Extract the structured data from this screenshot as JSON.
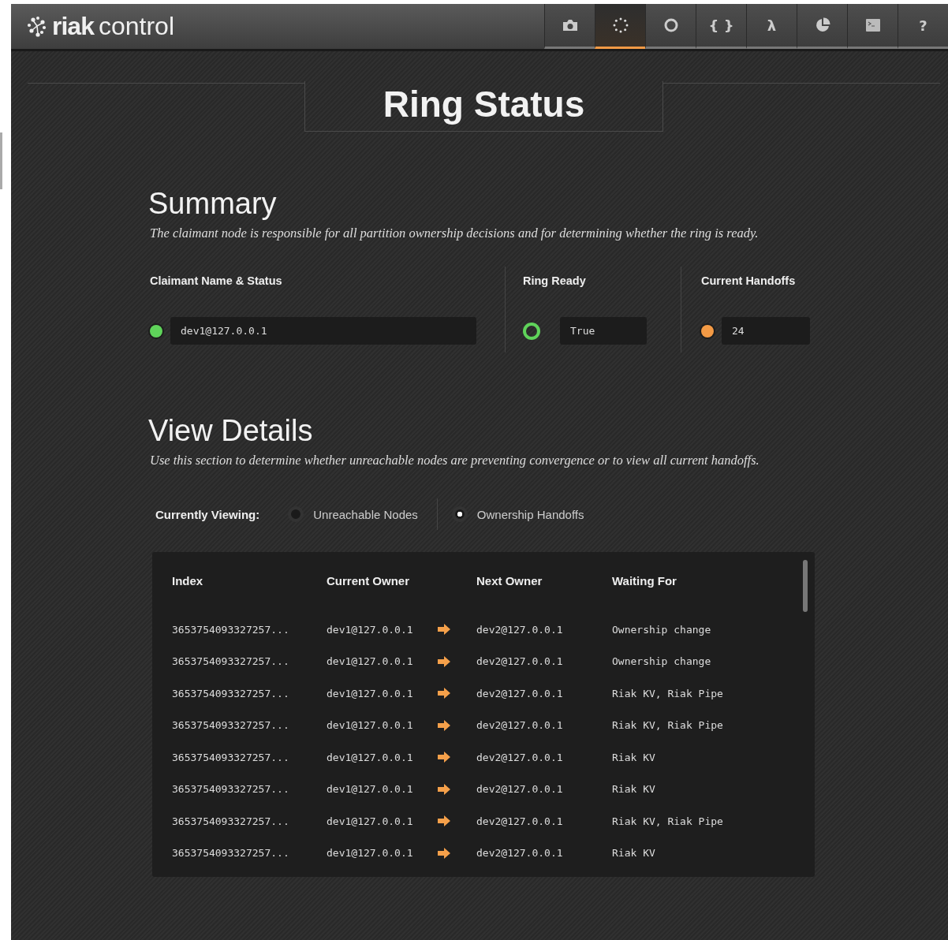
{
  "header": {
    "logo_bold": "riak",
    "logo_light": "control",
    "nav": [
      {
        "kind": "camera",
        "selected": false
      },
      {
        "kind": "ring",
        "selected": true
      },
      {
        "kind": "circle",
        "selected": false
      },
      {
        "kind": "text",
        "label": "{ }",
        "selected": false
      },
      {
        "kind": "text",
        "label": "λ",
        "selected": false
      },
      {
        "kind": "pie",
        "selected": false
      },
      {
        "kind": "terminal",
        "selected": false
      },
      {
        "kind": "text",
        "label": "?",
        "selected": false
      }
    ]
  },
  "page_title": "Ring Status",
  "summary": {
    "heading": "Summary",
    "description": "The claimant node is responsible for all partition ownership decisions and for determining whether the ring is ready.",
    "fields": [
      {
        "label": "Claimant Name & Status",
        "value": "dev1@127.0.0.1",
        "kind": "dot",
        "color": "#5fd35a"
      },
      {
        "label": "Ring Ready",
        "value": "True",
        "kind": "ring",
        "color": "#5fd35a"
      },
      {
        "label": "Current Handoffs",
        "value": "24",
        "kind": "dot",
        "color": "#f39a45"
      }
    ]
  },
  "view_details": {
    "heading": "View Details",
    "description": "Use this section to determine whether unreachable nodes are preventing convergence or to view all current handoffs.",
    "viewing_label": "Currently Viewing:",
    "options": [
      {
        "label": "Unreachable Nodes",
        "selected": false
      },
      {
        "label": "Ownership Handoffs",
        "selected": true
      }
    ]
  },
  "table": {
    "columns": [
      "Index",
      "Current Owner",
      "Next Owner",
      "Waiting For"
    ],
    "rows": [
      {
        "index": "3653754093327257...",
        "current_owner": "dev1@127.0.0.1",
        "next_owner": "dev2@127.0.0.1",
        "waiting_for": "Ownership change"
      },
      {
        "index": "3653754093327257...",
        "current_owner": "dev1@127.0.0.1",
        "next_owner": "dev2@127.0.0.1",
        "waiting_for": "Ownership change"
      },
      {
        "index": "3653754093327257...",
        "current_owner": "dev1@127.0.0.1",
        "next_owner": "dev2@127.0.0.1",
        "waiting_for": "Riak KV, Riak Pipe"
      },
      {
        "index": "3653754093327257...",
        "current_owner": "dev1@127.0.0.1",
        "next_owner": "dev2@127.0.0.1",
        "waiting_for": "Riak KV, Riak Pipe"
      },
      {
        "index": "3653754093327257...",
        "current_owner": "dev1@127.0.0.1",
        "next_owner": "dev2@127.0.0.1",
        "waiting_for": "Riak KV"
      },
      {
        "index": "3653754093327257...",
        "current_owner": "dev1@127.0.0.1",
        "next_owner": "dev2@127.0.0.1",
        "waiting_for": "Riak KV"
      },
      {
        "index": "3653754093327257...",
        "current_owner": "dev1@127.0.0.1",
        "next_owner": "dev2@127.0.0.1",
        "waiting_for": "Riak KV, Riak Pipe"
      },
      {
        "index": "3653754093327257...",
        "current_owner": "dev1@127.0.0.1",
        "next_owner": "dev2@127.0.0.1",
        "waiting_for": "Riak KV"
      }
    ]
  }
}
